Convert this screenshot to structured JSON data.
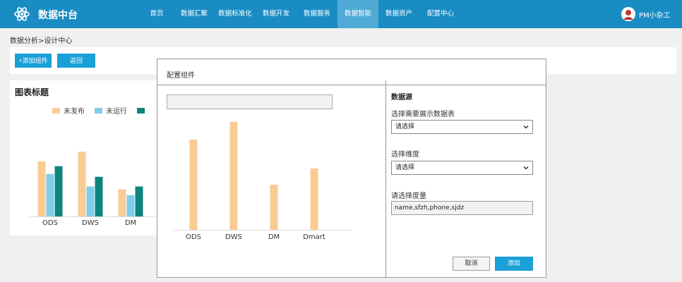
{
  "app": {
    "title": "数据中台",
    "logo_icon": "atom-icon"
  },
  "nav": {
    "items": [
      {
        "label": "首页",
        "active": false,
        "width": 48
      },
      {
        "label": "数据汇聚",
        "active": false,
        "width": 58
      },
      {
        "label": "数据标准化",
        "active": false,
        "width": 58
      },
      {
        "label": "数据开发",
        "active": false,
        "width": 58
      },
      {
        "label": "数据服务",
        "active": false,
        "width": 58
      },
      {
        "label": "数据智能",
        "active": true,
        "width": 58
      },
      {
        "label": "数据资产",
        "active": false,
        "width": 58
      },
      {
        "label": "配置中心",
        "active": false,
        "width": 60
      }
    ]
  },
  "user": {
    "name": "PM小杂工",
    "avatar_icon": "user-avatar"
  },
  "breadcrumb": "数据分析>设计中心",
  "actions": {
    "add_label": "+添加组件",
    "back_label": "返回"
  },
  "chart_panel": {
    "title": "图表标题",
    "legend": [
      {
        "name": "未发布",
        "color": "#f9cc93"
      },
      {
        "name": "未运行",
        "color": "#7fcdec"
      },
      {
        "name": "",
        "color": "#0e847e"
      }
    ]
  },
  "chart_data": [
    {
      "type": "bar",
      "title": "图表标题",
      "categories": [
        "ODS",
        "DWS",
        "DM"
      ],
      "series": [
        {
          "name": "未发布",
          "color": "#f9cc93",
          "values": [
            5.7,
            6.7,
            2.8
          ]
        },
        {
          "name": "未运行",
          "color": "#7fcdec",
          "values": [
            4.4,
            3.1,
            2.2
          ]
        },
        {
          "name": "",
          "color": "#0e847e",
          "values": [
            5.2,
            4.1,
            3.1
          ]
        }
      ],
      "ylim": [
        0,
        7
      ],
      "grid": false
    },
    {
      "type": "bar",
      "categories": [
        "ODS",
        "DWS",
        "DM",
        "Dmart"
      ],
      "series": [
        {
          "color": "#f9cc93",
          "values": [
            5.6,
            6.7,
            2.8,
            3.8
          ]
        }
      ],
      "ylim": [
        0,
        7
      ],
      "grid": false
    }
  ],
  "modal": {
    "title": "配置组件",
    "preview_input_value": "",
    "datasource": {
      "title": "数据源",
      "table_label": "选择需要展示数据表",
      "table_value": "请选择",
      "dimension_label": "选择维度",
      "dimension_value": "请选择",
      "measure_label": "请选择度量",
      "measure_value": "name,sfzh,phone,sjdz"
    },
    "cancel_label": "取消",
    "add_label": "添加"
  }
}
